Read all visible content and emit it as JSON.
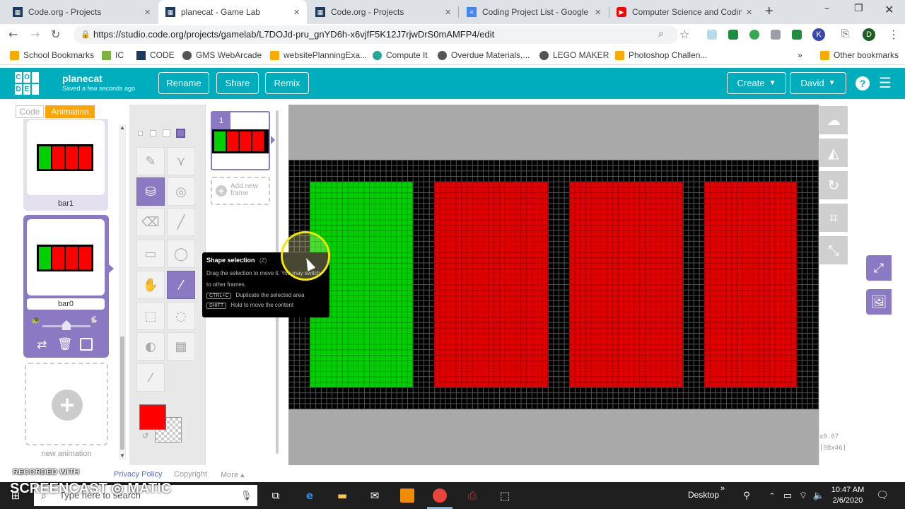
{
  "browser": {
    "tabs": [
      {
        "title": "Code.org - Projects",
        "active": false
      },
      {
        "title": "planecat - Game Lab",
        "active": true
      },
      {
        "title": "Code.org - Projects",
        "active": false
      },
      {
        "title": "Coding Project List - Google D",
        "active": false
      },
      {
        "title": "Computer Science and Coding",
        "active": false
      }
    ],
    "new_tab": "+",
    "url": "https://studio.code.org/projects/gamelab/L7DOJd-pru_gnYD6h-x6vjfF5K12J7rjwDrS0mAMFP4/edit",
    "profile_initial": "D",
    "ext_initial": "K",
    "bookmarks": [
      "School Bookmarks",
      "IC",
      "CODE",
      "GMS WebArcade",
      "websitePlanningExa...",
      "Compute It",
      "Overdue Materials,...",
      "LEGO MAKER",
      "Photoshop Challen..."
    ],
    "other_bookmarks": "Other bookmarks"
  },
  "app": {
    "logo_letters": [
      "C",
      "O",
      "D",
      "E"
    ],
    "project_name": "planecat",
    "save_status": "Saved a few seconds ago",
    "rename_label": "Rename",
    "share_label": "Share",
    "remix_label": "Remix",
    "create_label": "Create",
    "user_label": "David",
    "help_icon": "?"
  },
  "left_panel": {
    "tab_code": "Code",
    "tab_animation": "Animation",
    "animations": [
      {
        "name": "bar1",
        "selected": false
      },
      {
        "name": "bar0",
        "selected": true
      }
    ],
    "new_animation_label": "new animation"
  },
  "frames": {
    "frame_number": "1",
    "add_frame_label": "Add new frame"
  },
  "tooltip": {
    "title": "Shape selection",
    "shortcut": "(Z)",
    "body": "Drag the selection to move it. You may switch to other frames.",
    "key1": "CTRL+C",
    "key1_desc": "Duplicate the selected area",
    "key2": "SHIFT",
    "key2_desc": "Hold to move the content"
  },
  "canvas": {
    "zoom": "x9.07",
    "size": "[98x46]",
    "primary_color": "#ff0000",
    "bar_colors": [
      "#00d000",
      "#e00000",
      "#e00000",
      "#e00000"
    ]
  },
  "footer": {
    "recorded_with": "RECORDED WITH",
    "privacy_policy": "Privacy Policy",
    "copyright": "Copyright",
    "more": "More ▴",
    "watermark": "SCREENCAST ◎ MATIC"
  },
  "taskbar": {
    "search_placeholder": "Type here to search",
    "desktop_label": "Desktop",
    "time": "10:47 AM",
    "date": "2/6/2020"
  }
}
